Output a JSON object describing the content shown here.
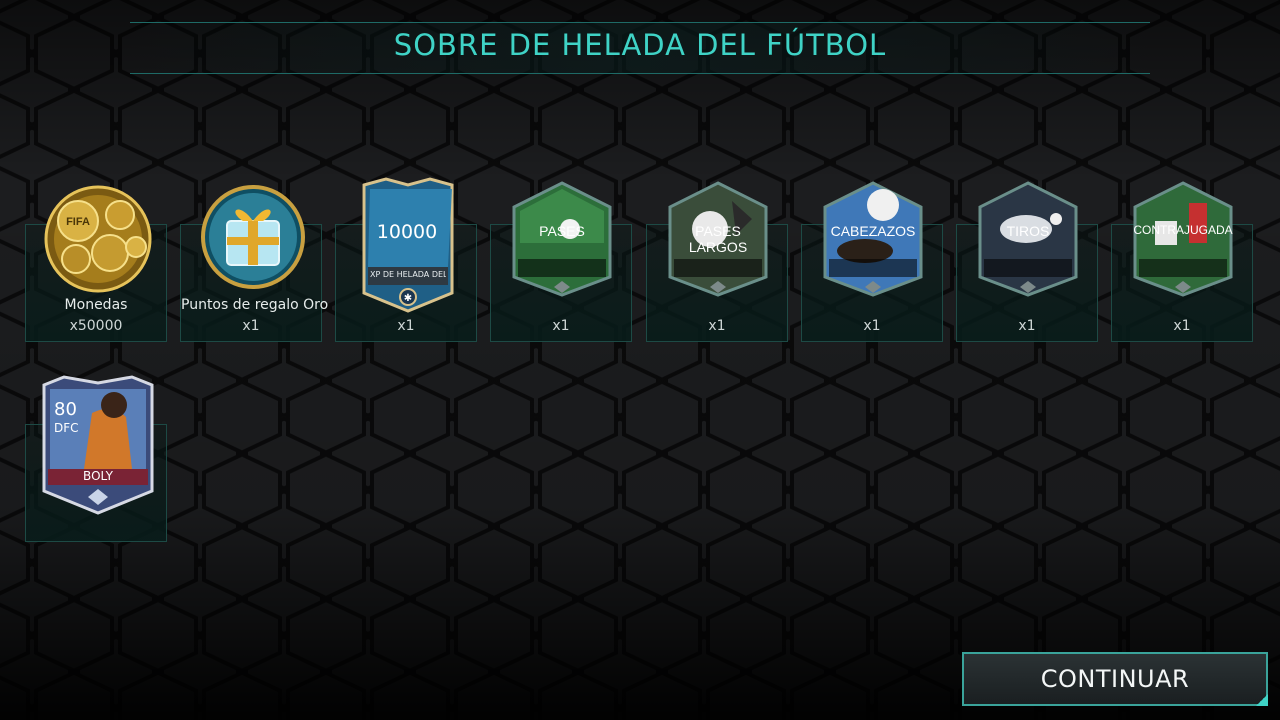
{
  "header": {
    "title": "SOBRE DE HELADA DEL FÚTBOL"
  },
  "rewards": [
    {
      "name": "Monedas",
      "qty": "x50000",
      "icon": "coins-icon"
    },
    {
      "name": "Puntos de regalo Oro",
      "qty": "x1",
      "icon": "gift-icon"
    },
    {
      "name": "",
      "qty": "x1",
      "card_value": "10000",
      "card_caption": "XP DE HELADA DEL FÚTBOL",
      "icon": "xp-card-icon"
    },
    {
      "label": "PASES",
      "qty": "x1",
      "icon": "skill-boost-icon"
    },
    {
      "label": "PASES LARGOS",
      "qty": "x1",
      "icon": "skill-boost-icon"
    },
    {
      "label": "CABEZAZOS",
      "qty": "x1",
      "icon": "skill-boost-icon"
    },
    {
      "label": "TIROS",
      "qty": "x1",
      "icon": "skill-boost-icon"
    },
    {
      "label": "CONTRAJUGADA",
      "qty": "x1",
      "icon": "skill-boost-icon"
    }
  ],
  "player_card": {
    "rating": "80",
    "position": "DFC",
    "name": "BOLY"
  },
  "footer": {
    "continue_label": "CONTINUAR"
  },
  "colors": {
    "accent": "#3fd3c6",
    "tile_border": "#1d4a45"
  }
}
